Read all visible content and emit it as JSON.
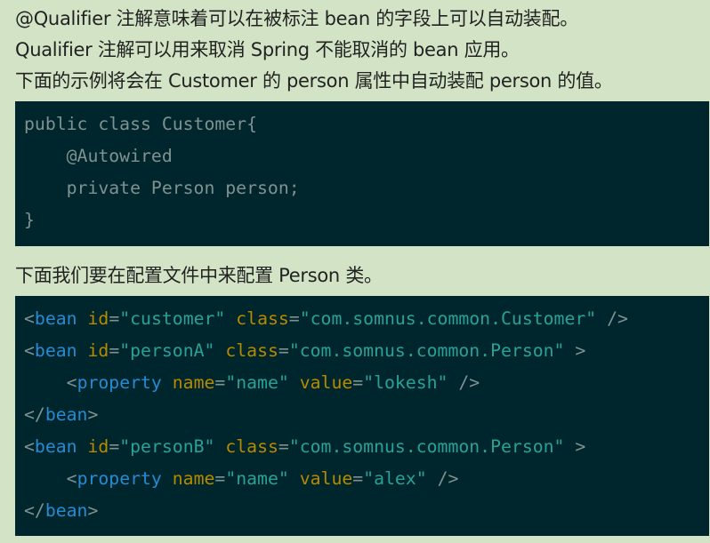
{
  "intro": [
    "@Qualifier 注解意味着可以在被标注 bean 的字段上可以自动装配。",
    "Qualifier 注解可以用来取消 Spring 不能取消的 bean 应用。",
    "下面的示例将会在 Customer 的 person 属性中自动装配 person 的值。"
  ],
  "code1": [
    [
      [
        "plain",
        "public class Customer{"
      ]
    ],
    [
      [
        "plain",
        "    @Autowired"
      ]
    ],
    [
      [
        "plain",
        "    private Person person;"
      ]
    ],
    [
      [
        "plain",
        "}"
      ]
    ]
  ],
  "middle_text": "下面我们要在配置文件中来配置 Person 类。",
  "code2": [
    [
      [
        "punc",
        "<"
      ],
      [
        "tag",
        "bean"
      ],
      [
        "plain",
        " "
      ],
      [
        "attr",
        "id"
      ],
      [
        "punc",
        "="
      ],
      [
        "str",
        "\"customer\""
      ],
      [
        "plain",
        " "
      ],
      [
        "attr",
        "class"
      ],
      [
        "punc",
        "="
      ],
      [
        "str",
        "\"com.somnus.common.Customer\""
      ],
      [
        "punc",
        " />"
      ]
    ],
    [
      [
        "punc",
        "<"
      ],
      [
        "tag",
        "bean"
      ],
      [
        "plain",
        " "
      ],
      [
        "attr",
        "id"
      ],
      [
        "punc",
        "="
      ],
      [
        "str",
        "\"personA\""
      ],
      [
        "plain",
        " "
      ],
      [
        "attr",
        "class"
      ],
      [
        "punc",
        "="
      ],
      [
        "str",
        "\"com.somnus.common.Person\""
      ],
      [
        "punc",
        " >"
      ]
    ],
    [
      [
        "plain",
        "    "
      ],
      [
        "punc",
        "<"
      ],
      [
        "tag",
        "property"
      ],
      [
        "plain",
        " "
      ],
      [
        "attr",
        "name"
      ],
      [
        "punc",
        "="
      ],
      [
        "str",
        "\"name\""
      ],
      [
        "plain",
        " "
      ],
      [
        "attr",
        "value"
      ],
      [
        "punc",
        "="
      ],
      [
        "str",
        "\"lokesh\""
      ],
      [
        "punc",
        " />"
      ]
    ],
    [
      [
        "punc",
        "</"
      ],
      [
        "tag",
        "bean"
      ],
      [
        "punc",
        ">"
      ]
    ],
    [
      [
        "punc",
        "<"
      ],
      [
        "tag",
        "bean"
      ],
      [
        "plain",
        " "
      ],
      [
        "attr",
        "id"
      ],
      [
        "punc",
        "="
      ],
      [
        "str",
        "\"personB\""
      ],
      [
        "plain",
        " "
      ],
      [
        "attr",
        "class"
      ],
      [
        "punc",
        "="
      ],
      [
        "str",
        "\"com.somnus.common.Person\""
      ],
      [
        "punc",
        " >"
      ]
    ],
    [
      [
        "plain",
        "    "
      ],
      [
        "punc",
        "<"
      ],
      [
        "tag",
        "property"
      ],
      [
        "plain",
        " "
      ],
      [
        "attr",
        "name"
      ],
      [
        "punc",
        "="
      ],
      [
        "str",
        "\"name\""
      ],
      [
        "plain",
        " "
      ],
      [
        "attr",
        "value"
      ],
      [
        "punc",
        "="
      ],
      [
        "str",
        "\"alex\""
      ],
      [
        "punc",
        " />"
      ]
    ],
    [
      [
        "punc",
        "</"
      ],
      [
        "tag",
        "bean"
      ],
      [
        "punc",
        ">"
      ]
    ]
  ],
  "colors": {
    "page_bg": "#d3e4c6",
    "code_bg": "#00262d",
    "tag": "#268bd2",
    "attr": "#b58900",
    "string": "#2aa198",
    "punctuation": "#7f9290"
  }
}
